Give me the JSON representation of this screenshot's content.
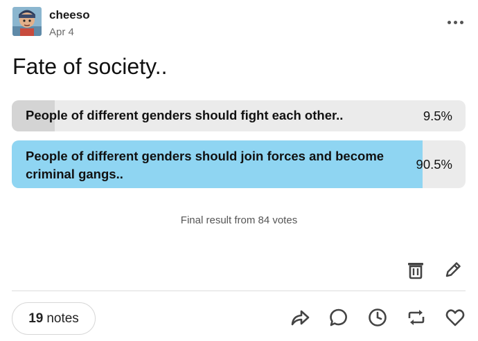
{
  "post": {
    "username": "cheeso",
    "date": "Apr 4",
    "avatar_icon": "avatar-image-icon"
  },
  "poll": {
    "title": "Fate of society..",
    "options": [
      {
        "text": "People of different genders should fight each other..",
        "percent_label": "9.5%",
        "percent": 9.5,
        "fill_color": "#d4d4d4"
      },
      {
        "text": "People of different genders should join forces and become criminal gangs..",
        "percent_label": "90.5%",
        "percent": 90.5,
        "fill_color": "#8fd5f2"
      }
    ],
    "result": "Final result from 84 votes"
  },
  "actions": {
    "more_icon": "more-horizontal-icon",
    "delete_icon": "trash-icon",
    "edit_icon": "pencil-icon",
    "share_icon": "share-arrow-icon",
    "reply_icon": "speech-bubble-icon",
    "schedule_icon": "clock-icon",
    "reblog_icon": "reblog-icon",
    "like_icon": "heart-icon"
  },
  "notes": {
    "count": "19",
    "label": "notes"
  }
}
